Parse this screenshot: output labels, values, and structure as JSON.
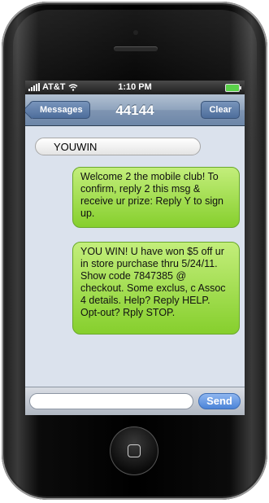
{
  "status_bar": {
    "carrier": "AT&T",
    "time": "1:10 PM"
  },
  "nav": {
    "back_label": "Messages",
    "title": "44144",
    "clear_label": "Clear"
  },
  "messages": [
    {
      "direction": "outgoing-sent",
      "text": "YOUWIN"
    },
    {
      "direction": "incoming",
      "text": "Welcome 2 the mobile club! To confirm, reply 2 this msg & receive ur prize: Reply Y to sign up."
    },
    {
      "direction": "incoming",
      "text": "YOU WIN! U have won $5 off ur in store purchase thru 5/24/11. Show code 7847385 @ checkout. Some exclus, c Assoc 4 details. Help? Reply HELP. Opt-out? Rply STOP."
    }
  ],
  "compose": {
    "value": "",
    "send_label": "Send"
  },
  "colors": {
    "nav_bar": "#7f95b2",
    "green_bubble": "#a3dd55",
    "screen_bg": "#dbe2ed",
    "send_button": "#4b84d8"
  },
  "icons": [
    "signal-bars-icon",
    "wifi-icon",
    "battery-icon",
    "home-button-icon"
  ]
}
